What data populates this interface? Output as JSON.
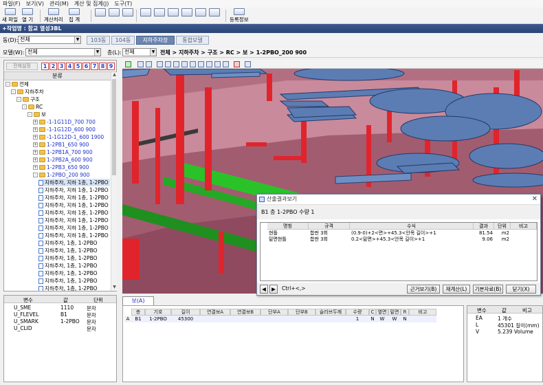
{
  "menubar": [
    "파일(F)",
    "보기(V)",
    "관리(M)",
    "계산 및 집계(J)",
    "도구(T)"
  ],
  "toolbar": {
    "new_file": "새 파일",
    "open": "열 기",
    "calculate": "계산처리",
    "aggregate": "집 계",
    "register": "등록정보"
  },
  "work_title": "+작업명 : 참교 열성3BL",
  "building": {
    "label": "동(D):",
    "value": "전체"
  },
  "tabs": [
    "103동",
    "104동",
    "지하주차장",
    "통합모델"
  ],
  "active_tab": 2,
  "model": {
    "label": "모델(W):",
    "value": "전체"
  },
  "floor": {
    "label": "층(L):",
    "value": "전체"
  },
  "breadcrumb": "전체 > 지하주차 > 구조 > RC > 보 > 1-2PBO_200 900",
  "left_tools": {
    "hide_button": "전체설정",
    "numbers": [
      "1",
      "2",
      "3",
      "4",
      "5",
      "6",
      "7",
      "8",
      "9"
    ]
  },
  "tree_header": "분류",
  "tree": [
    {
      "t": "전체",
      "lvl": 0,
      "kind": "fold",
      "exp": "-"
    },
    {
      "t": "지하주차",
      "lvl": 1,
      "kind": "fold",
      "exp": "-"
    },
    {
      "t": "구조",
      "lvl": 2,
      "kind": "fold",
      "exp": "-"
    },
    {
      "t": "RC",
      "lvl": 3,
      "kind": "fold",
      "exp": "-"
    },
    {
      "t": "보",
      "lvl": 4,
      "kind": "fold",
      "exp": "-"
    },
    {
      "t": "-1-1G11D_700 700",
      "lvl": 5,
      "kind": "fold",
      "exp": "+",
      "blue": true
    },
    {
      "t": "-1-1G12D_600 900",
      "lvl": 5,
      "kind": "fold",
      "exp": "+",
      "blue": true
    },
    {
      "t": "-1-1G12D-1_600 1900",
      "lvl": 5,
      "kind": "fold",
      "exp": "+",
      "blue": true
    },
    {
      "t": "1-2PB1_650 900",
      "lvl": 5,
      "kind": "fold",
      "exp": "+",
      "blue": true
    },
    {
      "t": "1-2PB1A_700 900",
      "lvl": 5,
      "kind": "fold",
      "exp": "+",
      "blue": true
    },
    {
      "t": "1-2PB2A_600 900",
      "lvl": 5,
      "kind": "fold",
      "exp": "+",
      "blue": true
    },
    {
      "t": "1-2PB3_650 900",
      "lvl": 5,
      "kind": "fold",
      "exp": "+",
      "blue": true
    },
    {
      "t": "1-2PBO_200 900",
      "lvl": 5,
      "kind": "fold",
      "exp": "-",
      "blue": true
    },
    {
      "t": "지하주차, 지하 1층, 1-2PBO",
      "lvl": 6,
      "kind": "doc",
      "sel": true
    },
    {
      "t": "지하주차, 지하 1층, 1-2PBO",
      "lvl": 6,
      "kind": "doc"
    },
    {
      "t": "지하주차, 지하 1층, 1-2PBO",
      "lvl": 6,
      "kind": "doc"
    },
    {
      "t": "지하주차, 지하 1층, 1-2PBO",
      "lvl": 6,
      "kind": "doc"
    },
    {
      "t": "지하주차, 지하 1층, 1-2PBO",
      "lvl": 6,
      "kind": "doc"
    },
    {
      "t": "지하주차, 지하 1층, 1-2PBO",
      "lvl": 6,
      "kind": "doc"
    },
    {
      "t": "지하주차, 지하 1층, 1-2PBO",
      "lvl": 6,
      "kind": "doc"
    },
    {
      "t": "지하주차, 지하 1층, 1-2PBO",
      "lvl": 6,
      "kind": "doc"
    },
    {
      "t": "지하주차, 1층, 1-2PBO",
      "lvl": 6,
      "kind": "doc"
    },
    {
      "t": "지하주차, 1층, 1-2PBO",
      "lvl": 6,
      "kind": "doc"
    },
    {
      "t": "지하주차, 1층, 1-2PBO",
      "lvl": 6,
      "kind": "doc"
    },
    {
      "t": "지하주차, 1층, 1-2PBO",
      "lvl": 6,
      "kind": "doc"
    },
    {
      "t": "지하주차, 1층, 1-2PBO",
      "lvl": 6,
      "kind": "doc"
    },
    {
      "t": "지하주차, 1층, 1-2PBO",
      "lvl": 6,
      "kind": "doc"
    },
    {
      "t": "지하주차, 1층, 1-2PBO",
      "lvl": 6,
      "kind": "doc"
    }
  ],
  "prop_left": {
    "headers": [
      "변수",
      "값",
      "단위"
    ],
    "rows": [
      [
        "U_SME",
        "1110",
        "문자"
      ],
      [
        "U_FLEVEL",
        "B1",
        "문자"
      ],
      [
        "U_SMARK",
        "1-2PBO",
        "문자"
      ],
      [
        "U_CLID",
        "",
        "문자"
      ]
    ]
  },
  "bottom_tab": "보(A)",
  "bottom_grid": {
    "headers": [
      "층",
      "기호",
      "길이",
      "연결보A",
      "연결보B",
      "단부A",
      "단부B",
      "슬라브두께",
      "수량",
      "C",
      "옆면",
      "밑면",
      "R",
      "비고"
    ],
    "row_label": "A",
    "row": [
      "B1",
      "1-2PBO",
      "45300",
      "",
      "",
      "",
      "",
      "",
      "1",
      "N",
      "W",
      "W",
      "N",
      ""
    ]
  },
  "prop_right": {
    "headers": [
      "변수",
      "값",
      "비고"
    ],
    "rows": [
      [
        "EA",
        "1 개수"
      ],
      [
        "L",
        "45301 길이(mm)"
      ],
      [
        "V",
        "5.239 Volume"
      ]
    ]
  },
  "dialog": {
    "title": "산출결과보기",
    "header": "B1 층 1-2PBO  수량 1",
    "columns": [
      "명칭",
      "규격",
      "수식",
      "결과",
      "단위",
      "비고"
    ],
    "rows": [
      [
        "현틀",
        "합판 3회",
        "(0.9-0)+2<면>+45.3<안목 길이>+1",
        "81.54",
        "m2",
        ""
      ],
      [
        "밑면현틀",
        "합판 3회",
        "0.2<밑면>+45.3<안목 길이>+1",
        "9.06",
        "m2",
        ""
      ]
    ],
    "nav_label": "Ctrl+<,>",
    "buttons": [
      "근거보기(B)",
      "재계산(L)",
      "기본자료(B)",
      "닫기(X)"
    ]
  }
}
